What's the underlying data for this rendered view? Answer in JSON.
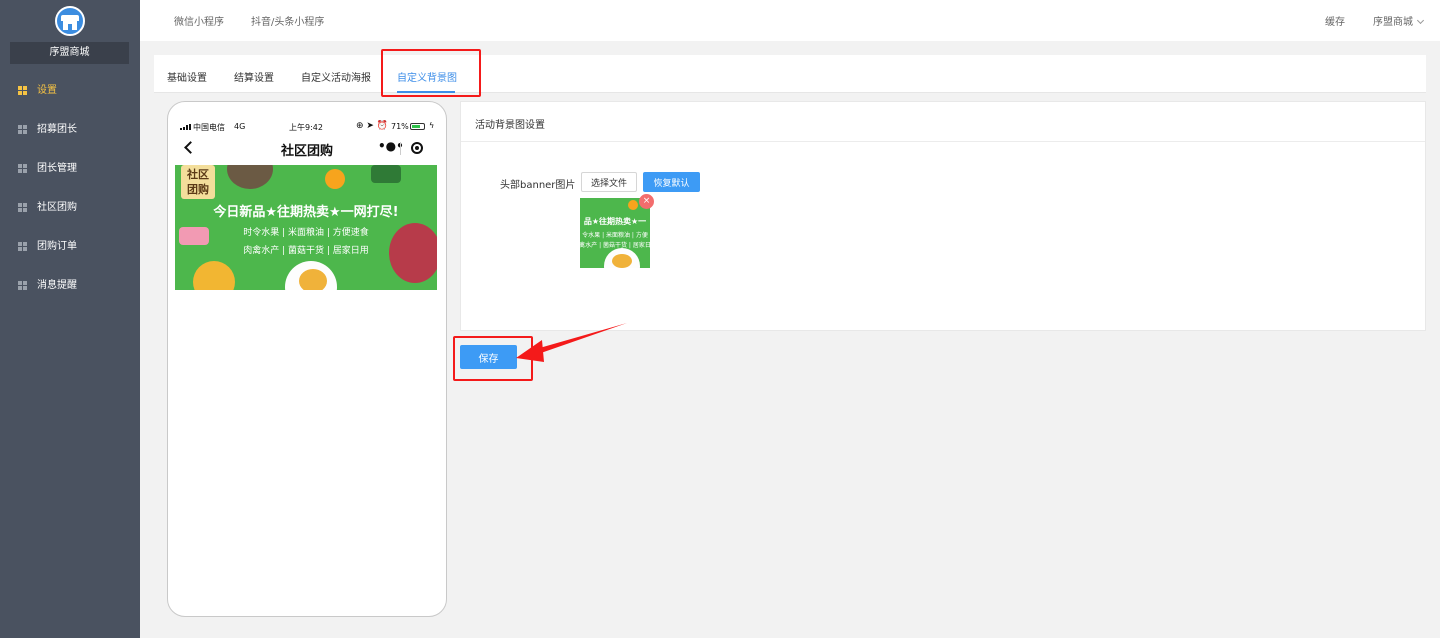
{
  "sidebar": {
    "store_name": "序盟商城",
    "items": [
      {
        "label": "设置",
        "active": true
      },
      {
        "label": "招募团长",
        "active": false
      },
      {
        "label": "团长管理",
        "active": false
      },
      {
        "label": "社区团购",
        "active": false
      },
      {
        "label": "团购订单",
        "active": false
      },
      {
        "label": "消息提醒",
        "active": false
      }
    ]
  },
  "topbar": {
    "links": [
      "微信小程序",
      "抖音/头条小程序"
    ],
    "cache": "缓存",
    "user": "序盟商城"
  },
  "tabs": [
    {
      "label": "基础设置",
      "active": false
    },
    {
      "label": "结算设置",
      "active": false
    },
    {
      "label": "自定义活动海报",
      "active": false
    },
    {
      "label": "自定义背景图",
      "active": true
    }
  ],
  "phone": {
    "carrier": "中国电信",
    "network": "4G",
    "time": "上午9:42",
    "battery": "71%",
    "battery_level": 0.71,
    "title": "社区团购",
    "more": "•●•",
    "banner": {
      "badge": "社区\n团购",
      "headline": "今日新品★往期热卖★一网打尽!",
      "line1": "时令水果 | 米面粮油 | 方便速食",
      "line2": "肉禽水产 | 菌菇干货 | 居家日用"
    }
  },
  "panel": {
    "title": "活动背景图设置",
    "field_label": "头部banner图片",
    "choose_file": "选择文件",
    "restore_default": "恢复默认",
    "thumb": {
      "headline": "品★往期热卖★一",
      "line1": "令水果 | 米面粮油 | 方便",
      "line2": "禽水产 | 菌菇干货 | 居家日"
    },
    "close": "×"
  },
  "save_label": "保存",
  "colors": {
    "sidebar_bg": "#4a5260",
    "active_nav": "#f6c343",
    "accent": "#3d9bf5",
    "highlight": "#f41a1a",
    "banner_green": "#4db74c"
  }
}
